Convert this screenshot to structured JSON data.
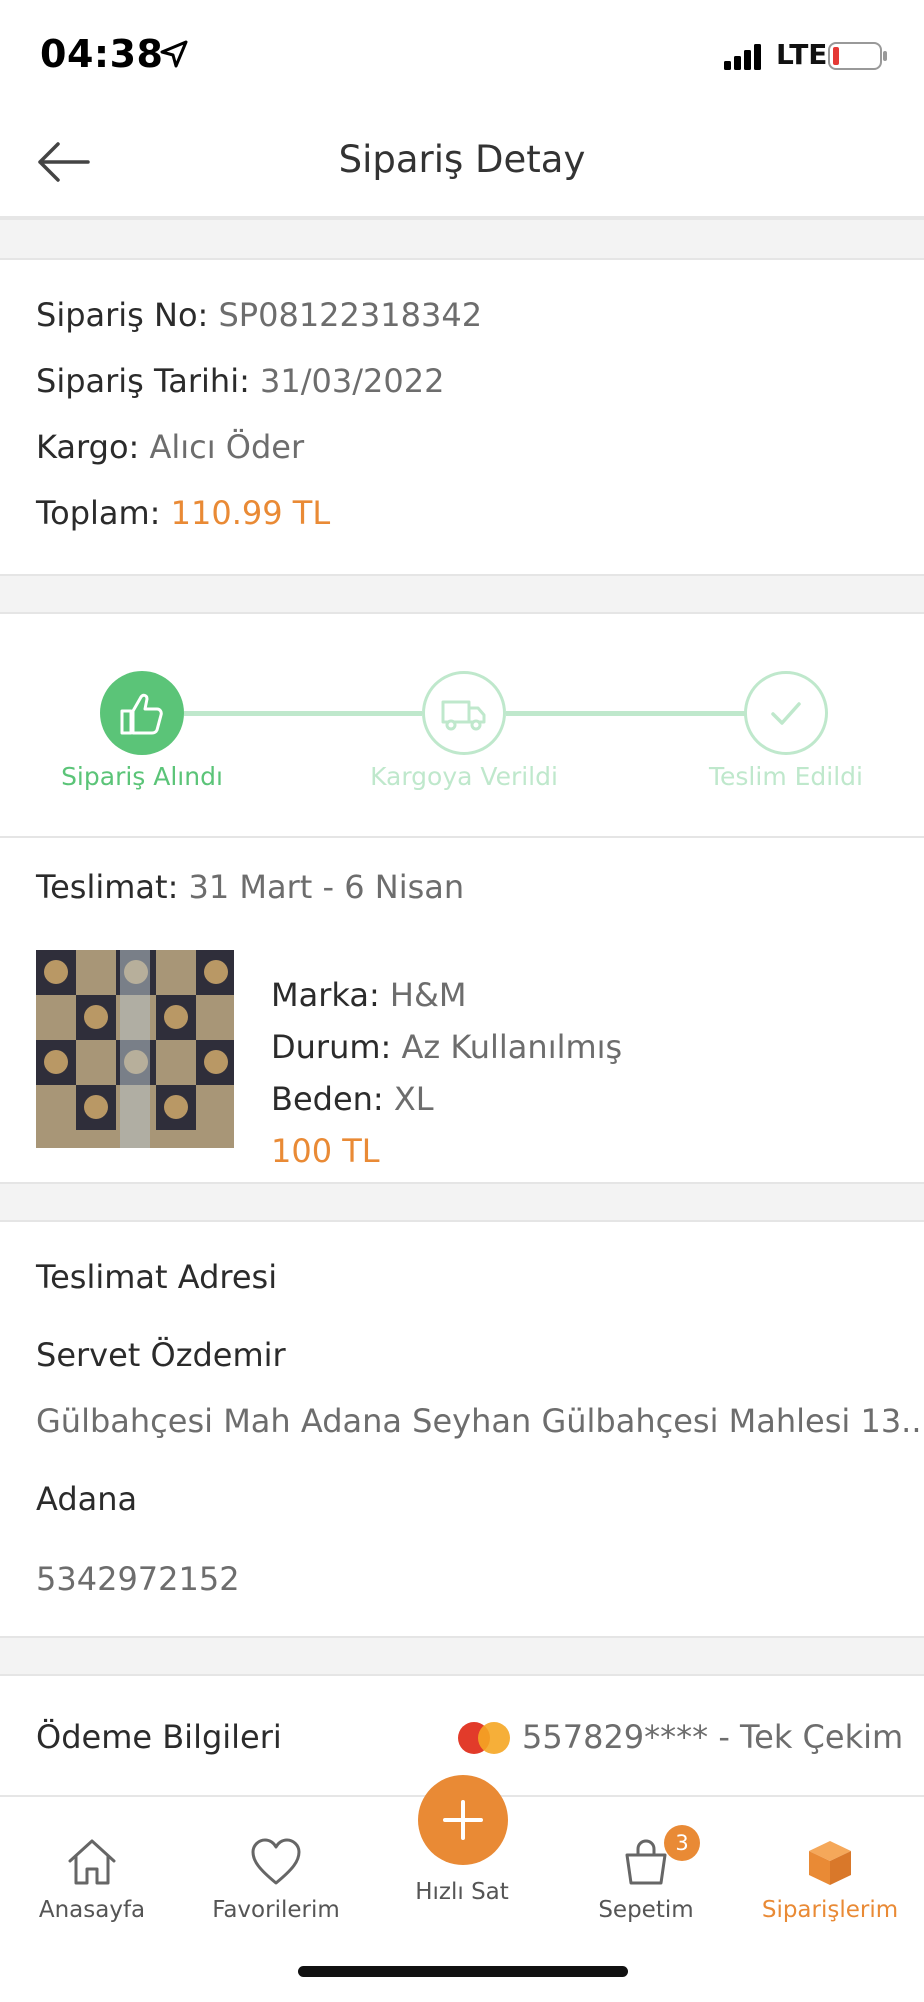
{
  "status_bar": {
    "time": "04:38",
    "network": "LTE"
  },
  "header": {
    "title": "Sipariş Detay"
  },
  "order": {
    "no_label": "Sipariş No:",
    "no_value": "SP08122318342",
    "date_label": "Sipariş Tarihi:",
    "date_value": "31/03/2022",
    "cargo_label": "Kargo:",
    "cargo_value": "Alıcı Öder",
    "total_label": "Toplam:",
    "total_value": "110.99 TL"
  },
  "tracker": {
    "steps": [
      {
        "label": "Sipariş Alındı",
        "state": "done"
      },
      {
        "label": "Kargoya Verildi",
        "state": "pending"
      },
      {
        "label": "Teslim Edildi",
        "state": "pending"
      }
    ]
  },
  "delivery": {
    "label": "Teslimat:",
    "value": "31 Mart - 6 Nisan"
  },
  "product": {
    "brand_label": "Marka:",
    "brand_value": "H&M",
    "condition_label": "Durum:",
    "condition_value": "Az Kullanılmış",
    "size_label": "Beden:",
    "size_value": "XL",
    "price": "100 TL"
  },
  "address": {
    "heading": "Teslimat Adresi",
    "name": "Servet Özdemir",
    "line": "Gülbahçesi Mah Adana Seyhan Gülbahçesi Mahlesi 13...",
    "city": "Adana",
    "phone": "5342972152"
  },
  "payment": {
    "heading": "Ödeme Bilgileri",
    "card": "557829**** - Tek Çekim",
    "card_brand_icon": "mastercard-icon"
  },
  "tabbar": {
    "tabs": [
      {
        "label": "Anasayfa",
        "icon": "home-icon"
      },
      {
        "label": "Favorilerim",
        "icon": "heart-icon"
      },
      {
        "label": "Hızlı Sat",
        "icon": "plus-icon"
      },
      {
        "label": "Sepetim",
        "icon": "bag-icon",
        "badge": "3"
      },
      {
        "label": "Siparişlerim",
        "icon": "box-icon",
        "active": true
      }
    ]
  },
  "colors": {
    "accent": "#e98a35",
    "success": "#5bc478",
    "success_light": "#bfe8cc"
  }
}
